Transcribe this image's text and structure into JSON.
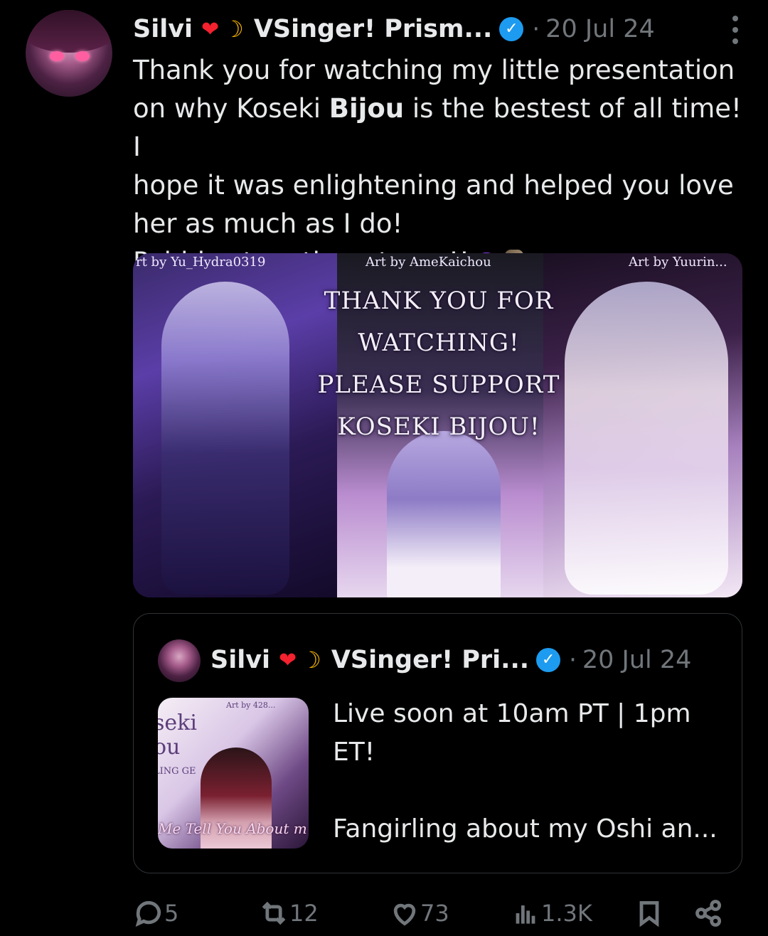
{
  "post": {
    "author": "Silvi",
    "author_suffix": "VSinger! Prism...",
    "dot": "·",
    "date": "20 Jul 24",
    "text_line1": "Thank you for watching my little presentation",
    "text_line2a": "on why Koseki ",
    "text_line2b": "Bijou",
    "text_line2c": " is the bestest of all time! I",
    "text_line3": "hope it was enlightening and helped you love",
    "text_line4": "her as much as I do!",
    "text_line5": "Pebbles together strong!!",
    "icons": [
      "heart-emoji",
      "crescent-moon-emoji",
      "verified-badge",
      "purple-heart-emoji",
      "moai-emoji"
    ]
  },
  "media": {
    "credit_left": "rt by Yu_Hydra0319",
    "credit_center": "Art by AmeKaichou",
    "credit_right": "Art by Yuurin...",
    "overlay_line1": "THANK YOU FOR",
    "overlay_line2": "WATCHING!",
    "overlay_line3": "PLEASE SUPPORT",
    "overlay_line4": "KOSEKI BIJOU!"
  },
  "quote": {
    "author": "Silvi",
    "author_suffix": "VSinger! Pri...",
    "dot": "·",
    "date": "20 Jul 24",
    "text_line1": "Live soon at 10am PT | 1pm",
    "text_line2": "ET!",
    "text_line3": "Fangirling about my Oshi an...",
    "thumb_text1": "seki",
    "thumb_text2": "ou",
    "thumb_text3": "LING GE",
    "thumb_text4": "Me Tell You About m",
    "thumb_text5": "Art by 428..."
  },
  "actions": {
    "replies": "5",
    "reposts": "12",
    "likes": "73",
    "views": "1.3K"
  }
}
